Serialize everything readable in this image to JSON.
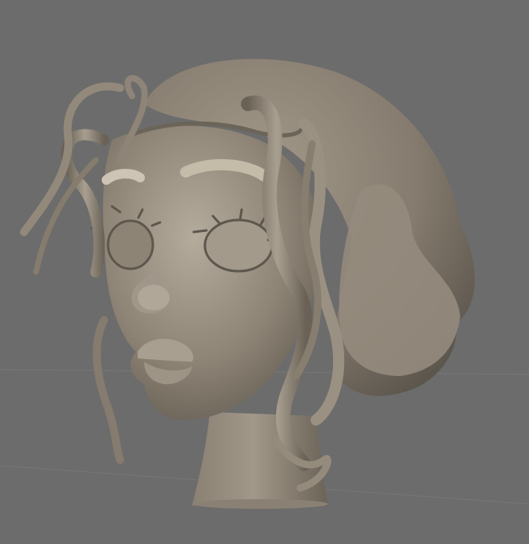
{
  "viewport": {
    "background_color": "#6c6c6c",
    "grid_line_color": "#767676",
    "show_grid_floor": true
  },
  "sculpt": {
    "subject": "stylized-female-head-bust",
    "material_color": "#8c8274",
    "material_shadow": "#5e574d",
    "material_highlight": "#b4ab9c"
  }
}
